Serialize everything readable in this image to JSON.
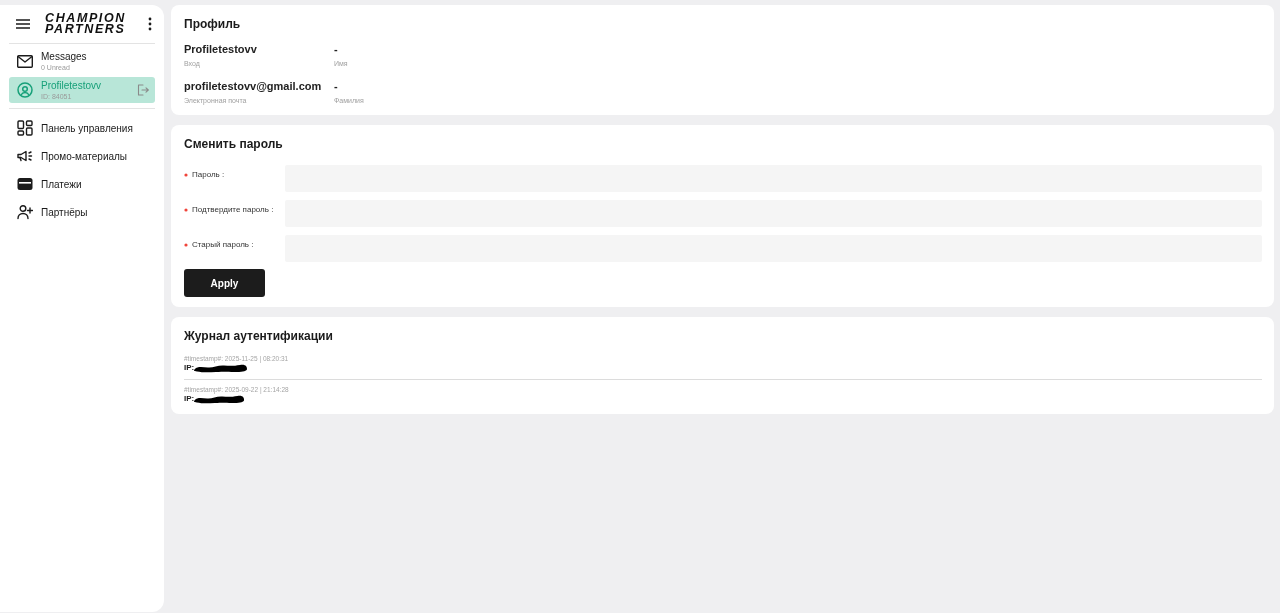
{
  "sidebar": {
    "logo_lines": [
      "CHAMPION",
      "PARTNERS"
    ],
    "account_items": [
      {
        "kind": "messages",
        "title": "Messages",
        "subtitle": "0 Unread",
        "selected": false
      },
      {
        "kind": "profile",
        "title": "Profiletestovv",
        "subtitle": "ID: 84051",
        "selected": true
      }
    ],
    "nav_items": [
      {
        "kind": "dashboard",
        "label": "Панель управления",
        "selected": false
      },
      {
        "kind": "promo",
        "label": "Промо-материалы",
        "selected": false
      },
      {
        "kind": "payments",
        "label": "Платежи",
        "selected": false
      },
      {
        "kind": "partners",
        "label": "Партнёры",
        "selected": false
      }
    ]
  },
  "profile": {
    "title": "Профиль",
    "fields": [
      {
        "value": "Profiletestovv",
        "label": "Вход"
      },
      {
        "value": "-",
        "label": "Имя"
      },
      {
        "value": "profiletestovv@gmail.com",
        "label": "Электронная почта"
      },
      {
        "value": "-",
        "label": "Фамилия"
      }
    ]
  },
  "change_password": {
    "title": "Сменить пароль",
    "fields": [
      {
        "label": "Пароль :",
        "required": true
      },
      {
        "label": "Подтвердите пароль :",
        "required": true
      },
      {
        "label": "Старый пароль :",
        "required": true
      }
    ],
    "button": "Apply"
  },
  "auth_log": {
    "title": "Журнал аутентификации",
    "entries": [
      {
        "timestamp": "#timestamp#: 2025-11-25 | 08:20:31",
        "ip_label": "IP:",
        "redacted": true
      },
      {
        "timestamp": "#timestamp#: 2025-09-22 | 21:14:28",
        "ip_label": "IP:",
        "redacted": true
      }
    ]
  }
}
